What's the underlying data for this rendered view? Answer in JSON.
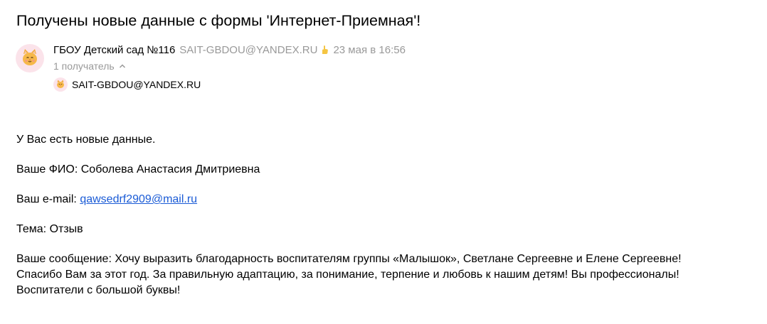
{
  "subject": "Получены новые данные с формы 'Интернет-Приемная'!",
  "sender": {
    "name": "ГБОУ Детский сад №116",
    "email": "SAIT-GBDOU@YANDEX.RU",
    "date": "23 мая в 16:56",
    "avatar_icon": "cat-face-icon",
    "badge_icon": "verified-hand-icon"
  },
  "recipients": {
    "toggle_label": "1 получатель",
    "list": [
      {
        "email": "SAIT-GBDOU@YANDEX.RU"
      }
    ]
  },
  "message": {
    "intro": "У Вас есть новые данные.",
    "fio_label": "Ваше ФИО: ",
    "fio_value": "Соболева Анастасия Дмитриевна",
    "email_label": "Ваш e-mail: ",
    "email_value": "qawsedrf2909@mail.ru",
    "topic_label": "Тема: ",
    "topic_value": "Отзыв",
    "msg_label": "Ваше сообщение: ",
    "msg_line1": "Хочу выразить благодарность воспитателям группы «Малышок», Светлане Сергеевне и Елене Сергеевне!",
    "msg_line2": "Спасибо Вам за этот год. За правильную адаптацию, за понимание, терпение и любовь к нашим детям! Вы профессионалы!",
    "msg_line3": "Воспитатели с большой буквы!"
  },
  "colors": {
    "muted": "#999999",
    "link": "#1a5bd6",
    "avatar_bg": "#fbe3ea",
    "badge": "#f5c542"
  }
}
